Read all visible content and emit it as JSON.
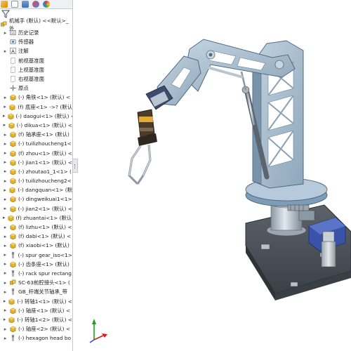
{
  "root": {
    "label": "机械手 (默认) <<默认>_外"
  },
  "tree": [
    {
      "label": "历史记录",
      "icon": "history-icon",
      "expandable": true
    },
    {
      "label": "传感器",
      "icon": "sensor-icon",
      "expandable": false
    },
    {
      "label": "注解",
      "icon": "annotation-icon",
      "expandable": true
    },
    {
      "label": "前视基准面",
      "icon": "plane-icon",
      "expandable": false
    },
    {
      "label": "上视基准面",
      "icon": "plane-icon",
      "expandable": false
    },
    {
      "label": "右视基准面",
      "icon": "plane-icon",
      "expandable": false
    },
    {
      "label": "原点",
      "icon": "origin-icon",
      "expandable": false
    },
    {
      "label": "(-) 角铁<1> (默认) <",
      "icon": "part-icon",
      "expandable": true
    },
    {
      "label": "(f) 底座<1> ->? (默认",
      "icon": "part-icon",
      "expandable": true
    },
    {
      "label": "(-) daogui<1> (默认) <",
      "icon": "part-icon",
      "expandable": true
    },
    {
      "label": "(-) dikua<1> (默认) <",
      "icon": "part-icon",
      "expandable": true
    },
    {
      "label": "(f) 轴承座<1> (默认)",
      "icon": "part-icon",
      "expandable": true
    },
    {
      "label": "(-) tuilizhoucheng1<",
      "icon": "part-icon",
      "expandable": true
    },
    {
      "label": "(f) zhou<1> (默认) <",
      "icon": "part-icon",
      "expandable": true
    },
    {
      "label": "(-) jian1<1> (默认) <",
      "icon": "part-icon",
      "expandable": true
    },
    {
      "label": "(-) zhoutao1_1<1> (",
      "icon": "part-icon",
      "expandable": true
    },
    {
      "label": "(-) tuilizhoucheng2<",
      "icon": "part-icon",
      "expandable": true
    },
    {
      "label": "(-) dangquan<1> (默",
      "icon": "part-icon",
      "expandable": true
    },
    {
      "label": "(-) dingweikuai1<1>",
      "icon": "part-icon",
      "expandable": true
    },
    {
      "label": "(-) jian2<1> (默认) <",
      "icon": "part-icon",
      "expandable": true
    },
    {
      "label": "(f) zhuantai<1> (默认)",
      "icon": "part-icon",
      "expandable": true
    },
    {
      "label": "(f) lizhu<1> (默认) <",
      "icon": "part-icon",
      "expandable": true
    },
    {
      "label": "(f) dabi<1> (默认) <",
      "icon": "part-icon",
      "expandable": true
    },
    {
      "label": "(f) xiaobi<1> (默认)",
      "icon": "part-icon",
      "expandable": true
    },
    {
      "label": "(-) spur gear_iso<1>",
      "icon": "toolbox-part-icon",
      "expandable": true
    },
    {
      "label": "(-) 齿条座<1> (默认)",
      "icon": "part-icon",
      "expandable": true
    },
    {
      "label": "(-) rack spur rectang",
      "icon": "toolbox-part-icon",
      "expandable": true
    },
    {
      "label": "SC-63前腔接头<1> (",
      "icon": "assembly-icon",
      "expandable": true
    },
    {
      "label": "GB_杆端关节轴承_带",
      "icon": "toolbox-part-icon",
      "expandable": true
    },
    {
      "label": "(-) 转轴1<1> (默认) <",
      "icon": "part-icon",
      "expandable": true
    },
    {
      "label": "(-) 轴座<1> (默认) <",
      "icon": "part-icon",
      "expandable": true
    },
    {
      "label": "(-) 转轴1<2> (默认) <",
      "icon": "part-icon",
      "expandable": true
    },
    {
      "label": "(-) 轴座<2> (默认) <",
      "icon": "part-icon",
      "expandable": true
    },
    {
      "label": "(-) hexagon head bo",
      "icon": "toolbox-part-icon",
      "expandable": true
    }
  ],
  "colors": {
    "part": "#e6b31e",
    "arm": "#a9bfd1",
    "arm_dark": "#6f8da6",
    "base": "#4a4f57",
    "bracket": "#5a6fb0"
  }
}
